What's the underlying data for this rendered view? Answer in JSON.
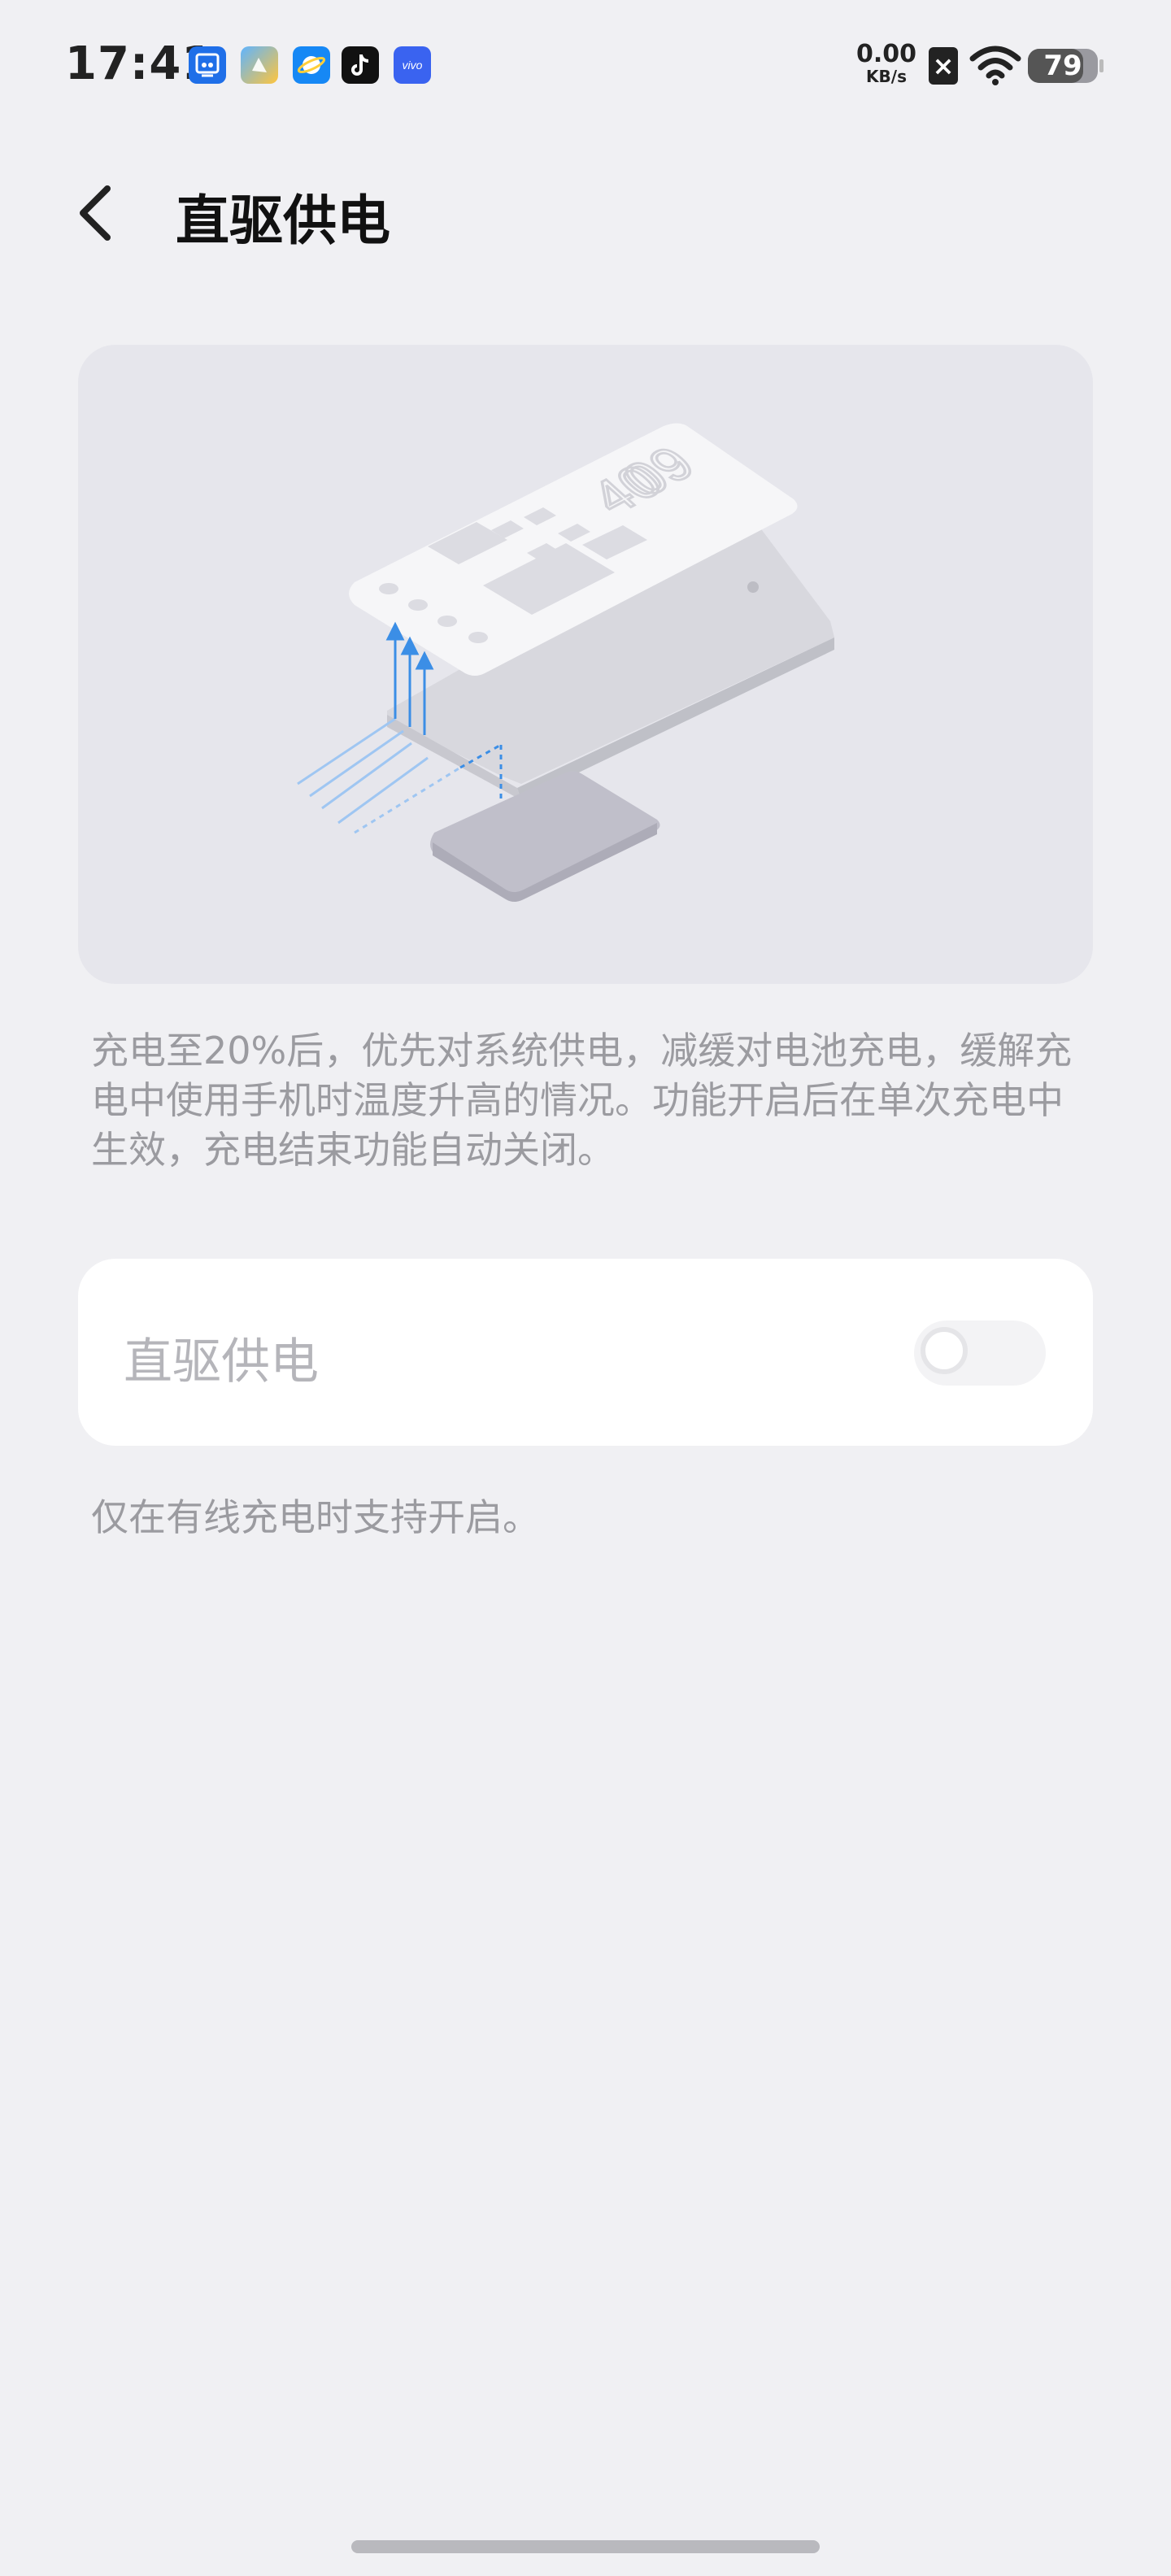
{
  "status_bar": {
    "time": "17:41",
    "net_speed_value": "0.00",
    "net_speed_unit": "KB/s",
    "battery_level": "79",
    "app_icons": [
      "scissors-app-icon",
      "gallery-app-icon",
      "browser-app-icon",
      "tiktok-icon",
      "vivo-icon"
    ],
    "vivo_label": "vivo"
  },
  "header": {
    "title": "直驱供电"
  },
  "illustration": {
    "clock_digits_top": "09",
    "clock_digits_bottom": "40"
  },
  "description": "充电至20%后，优先对系统供电，减缓对电池充电，缓解充电中使用手机时温度升高的情况。功能开启后在单次充电中生效，充电结束功能自动关闭。",
  "toggle": {
    "label": "直驱供电",
    "enabled": false
  },
  "footnote": "仅在有线充电时支持开启。",
  "colors": {
    "background": "#f0f0f3",
    "card": "#ffffff",
    "illustration_bg": "#e6e6ec",
    "arrow_blue": "#3b8ee6",
    "secondary_text": "#9b9ba0"
  }
}
